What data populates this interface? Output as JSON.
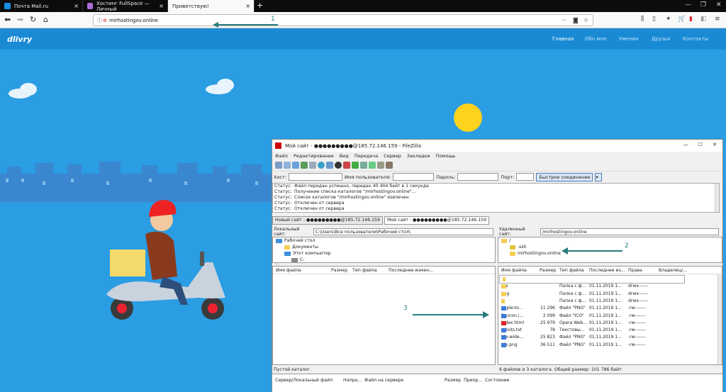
{
  "browser": {
    "tabs": [
      {
        "label": "Почта Mail.ru"
      },
      {
        "label": "Хостинг FullSpace — Личный"
      },
      {
        "label": "Приветствую!"
      }
    ],
    "url": "mirhostingov.online",
    "new_tab": "+",
    "annotation_1": "1"
  },
  "site": {
    "logo": "dlivry",
    "menu": [
      "Главная",
      "Обо мне",
      "Умения",
      "Друзья",
      "Контакты"
    ]
  },
  "filezilla": {
    "title": "Мой сайт - ●●●●●●●●●@185.72.146.159 - FileZilla",
    "menu": [
      "Файл",
      "Редактирование",
      "Вид",
      "Передача",
      "Сервер",
      "Закладки",
      "Помощь"
    ],
    "quickconnect": {
      "host_label": "Хост:",
      "user_label": "Имя пользователя:",
      "pass_label": "Пароль:",
      "port_label": "Порт:",
      "button": "Быстрое соединение"
    },
    "log": [
      {
        "k": "Статус:",
        "v": "Файл передан успешно, передан 40 404 байт в 1 секунда"
      },
      {
        "k": "Статус:",
        "v": "Получение списка каталогов \"/mirhostingov.online\"..."
      },
      {
        "k": "Статус:",
        "v": "Список каталогов \"/mirhostingov.online\" извлечен"
      },
      {
        "k": "Статус:",
        "v": "Отключен от сервера"
      },
      {
        "k": "Статус:",
        "v": "Отключен от сервера"
      }
    ],
    "tabs": [
      "Новый сайт - ●●●●●●●●●@185.72.146.159",
      "Мой сайт - ●●●●●●●●●@185.72.146.159"
    ],
    "local": {
      "label": "Локальный сайт:",
      "path": "C:\\Users\\Все пользователи\\Рабочий стол\\",
      "tree": [
        "Рабочий стол",
        "Документы",
        "Этот компьютер",
        "C:"
      ],
      "headers": [
        "Имя файла",
        "Размер",
        "Тип файла",
        "Последнее измен..."
      ],
      "files": [
        ".."
      ],
      "status": "Пустой каталог."
    },
    "remote": {
      "label": "Удаленный сайт:",
      "path": "/mirhostingov.online",
      "tree": [
        "/",
        ".ssh",
        "mirhostingov.online"
      ],
      "headers": [
        "Имя файла",
        "Размер",
        "Тип файла",
        "Последнее из...",
        "Права",
        "Владелец/..."
      ],
      "files": [
        {
          "name": "..",
          "size": "",
          "type": "",
          "date": "",
          "perm": ""
        },
        {
          "name": "css",
          "size": "",
          "type": "Папка с ф...",
          "date": "01.11.2019 1...",
          "perm": "drwx------"
        },
        {
          "name": "img",
          "size": "",
          "type": "Папка с ф...",
          "date": "01.11.2019 1...",
          "perm": "drwx------"
        },
        {
          "name": "js",
          "size": "",
          "type": "Папка с ф...",
          "date": "01.11.2019 1...",
          "perm": "drwx------"
        },
        {
          "name": "apple-to...",
          "size": "11 296",
          "type": "Файл \"PNG\"",
          "date": "01.11.2019 1...",
          "perm": "-rw-------"
        },
        {
          "name": "favicon.i...",
          "size": "2 099",
          "type": "Файл \"ICO\"",
          "date": "01.11.2019 1...",
          "perm": "-rw-------"
        },
        {
          "name": "index.html",
          "size": "25 979",
          "type": "Opera Web...",
          "date": "01.11.2019 1...",
          "perm": "-rw-------"
        },
        {
          "name": "robots.txt",
          "size": "78",
          "type": "Текстовы...",
          "date": "01.11.2019 1...",
          "perm": "-rw-------"
        },
        {
          "name": "tile-wide...",
          "size": "25 823",
          "type": "Файл \"PNG\"",
          "date": "01.11.2019 1...",
          "perm": "-rw-------"
        },
        {
          "name": "tile.png",
          "size": "36 511",
          "type": "Файл \"PNG\"",
          "date": "01.11.2019 1...",
          "perm": "-rw-------"
        }
      ],
      "status": "6 файлов и 3 каталога. Общий размер: 101 786 байт"
    },
    "queue": [
      "Сервер/Локальный файл",
      "Напра...",
      "Файл на сервере",
      "Размер",
      "Приор...",
      "Состояние"
    ]
  },
  "annotations": {
    "a2": "2",
    "a3": "3"
  },
  "colors": {
    "sky": "#2a9de3",
    "sun": "#ffd21e",
    "accent": "#2a7b7b"
  }
}
